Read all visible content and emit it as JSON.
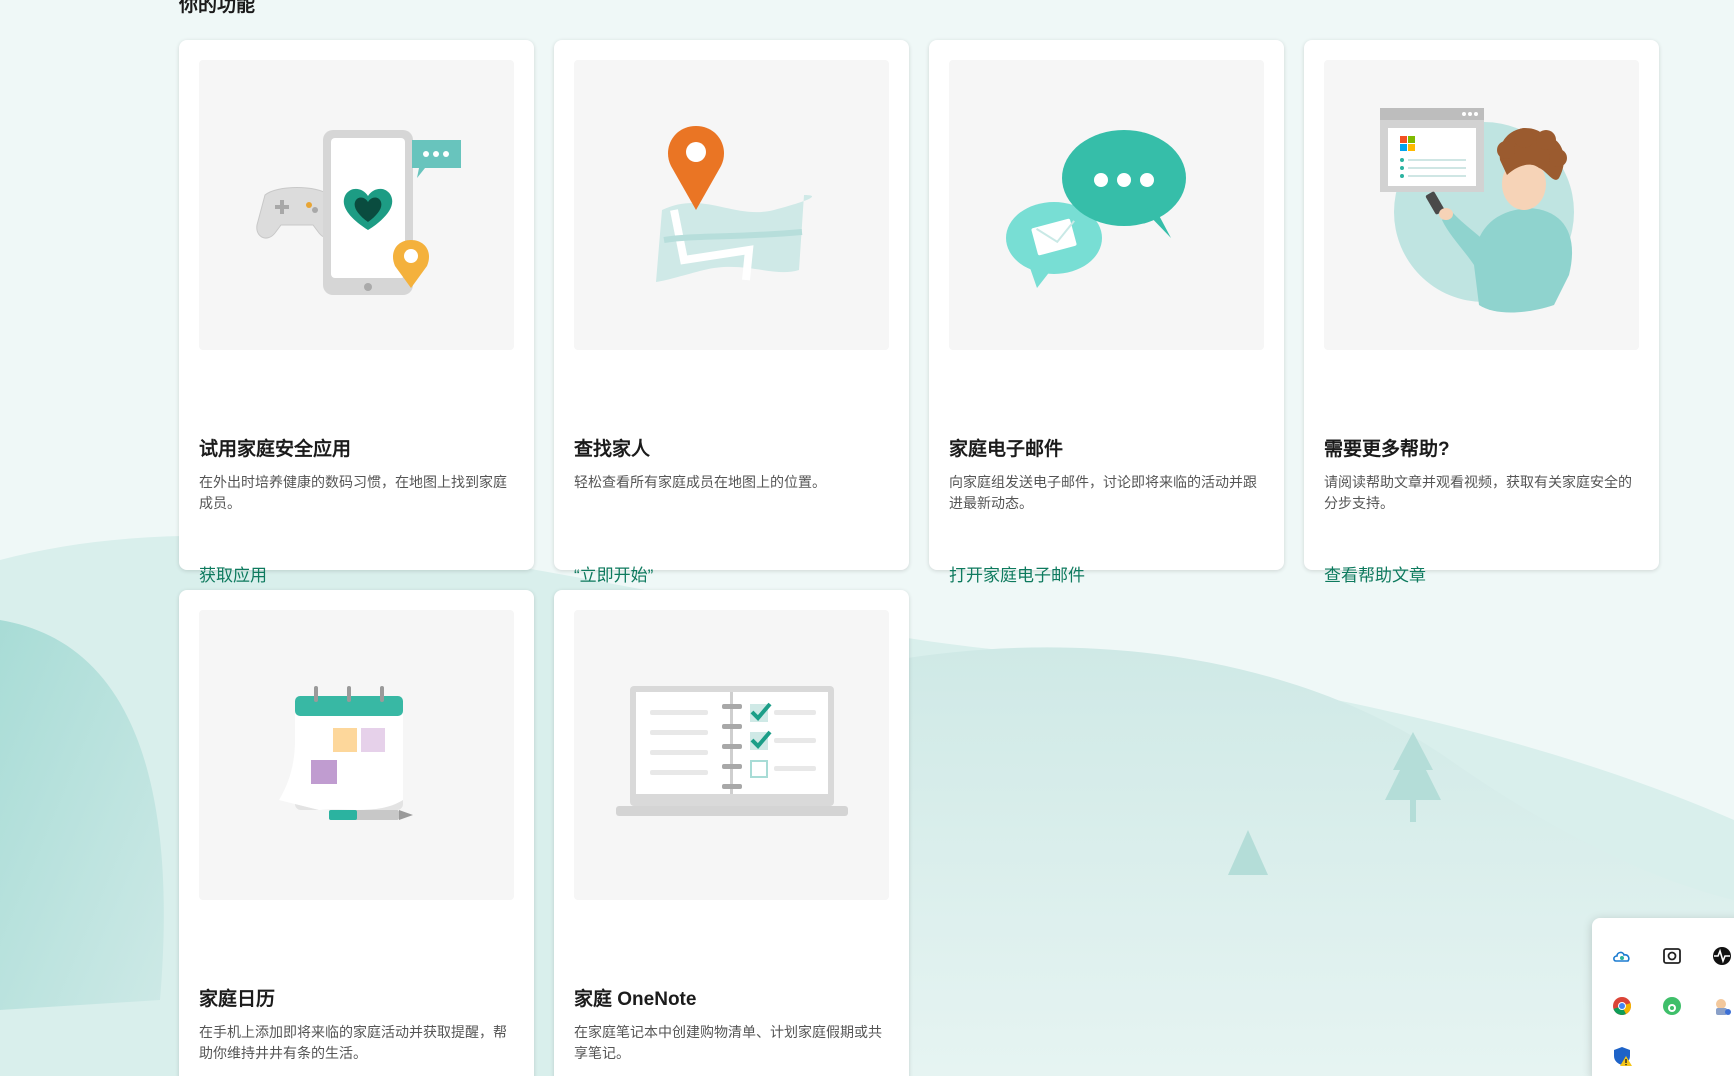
{
  "page": {
    "section_title": "你的功能"
  },
  "cards": [
    {
      "title": "试用家庭安全应用",
      "description": "在外出时培养健康的数码习惯，在地图上找到家庭成员。",
      "link": "获取应用",
      "illustration": "phone-heart-gamepad-icon"
    },
    {
      "title": "查找家人",
      "description": "轻松查看所有家庭成员在地图上的位置。",
      "link": "“立即开始”",
      "illustration": "map-pin-icon"
    },
    {
      "title": "家庭电子邮件",
      "description": "向家庭组发送电子邮件，讨论即将来临的活动并跟进最新动态。",
      "link": "打开家庭电子邮件",
      "illustration": "chat-mail-icon"
    },
    {
      "title": "需要更多帮助?",
      "description": "请阅读帮助文章并观看视频，获取有关家庭安全的分步支持。",
      "link": "查看帮助文章",
      "illustration": "person-help-icon"
    },
    {
      "title": "家庭日历",
      "description": "在手机上添加即将来临的家庭活动并获取提醒，帮助你维持井井有条的生活。",
      "link": "",
      "illustration": "calendar-icon"
    },
    {
      "title": "家庭 OneNote",
      "description": "在家庭笔记本中创建购物清单、计划家庭假期或共享笔记。",
      "link": "",
      "illustration": "notebook-checklist-icon"
    }
  ],
  "tray": {
    "icons": [
      "onedrive-icon",
      "screenshot-tool-icon",
      "activity-monitor-icon",
      "chrome-icon",
      "network-globe-icon",
      "app-avatar-icon",
      "security-shield-warning-icon"
    ]
  },
  "colors": {
    "accent_link": "#0e7a5e",
    "background": "#eef7f6",
    "teal": "#3bbfad",
    "orange": "#ec7a2a"
  }
}
